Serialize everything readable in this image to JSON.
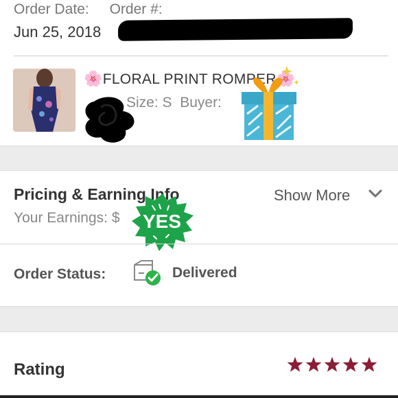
{
  "order": {
    "date_label": "Order Date:",
    "number_label": "Order #:",
    "date_value": "Jun 25, 2018"
  },
  "product": {
    "title": "FLORAL PRINT ROMPER",
    "size_text": "Size: S",
    "buyer_text": "Buyer: "
  },
  "stickers": {
    "yes_text": "YES"
  },
  "pricing": {
    "title": "Pricing & Earning Info",
    "show_more": "Show More",
    "earnings_text": "Your Earnings: $"
  },
  "status": {
    "label": "Order Status:",
    "value": "Delivered"
  },
  "rating": {
    "label": "Rating",
    "stars": 5,
    "star_color": "#8b1e35"
  },
  "colors": {
    "accent_green": "#2db34a",
    "badge_green": "#1fa34a"
  }
}
